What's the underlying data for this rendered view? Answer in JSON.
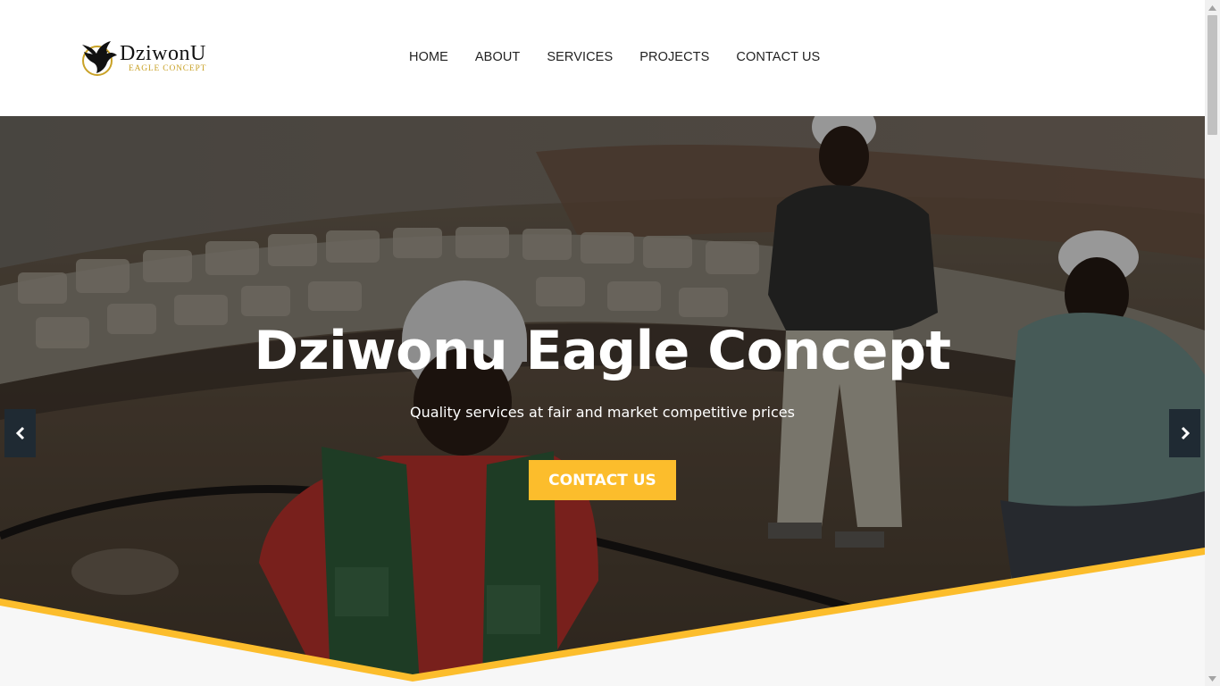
{
  "brand": {
    "name": "DziwonU",
    "tagline": "EAGLE CONCEPT"
  },
  "nav": {
    "items": [
      {
        "label": "HOME"
      },
      {
        "label": "ABOUT"
      },
      {
        "label": "SERVICES"
      },
      {
        "label": "PROJECTS"
      },
      {
        "label": "CONTACT US"
      }
    ]
  },
  "hero": {
    "title": "Dziwonu Eagle Concept",
    "subtitle": "Quality services at fair and market competitive prices",
    "cta_label": "CONTACT US",
    "prev_icon": "chevron-left-icon",
    "next_icon": "chevron-right-icon"
  },
  "colors": {
    "accent": "#fcbd2c",
    "arrow_bg": "#1f2a33",
    "header_bg": "#ffffff",
    "section_bg": "#f7f7f7"
  }
}
